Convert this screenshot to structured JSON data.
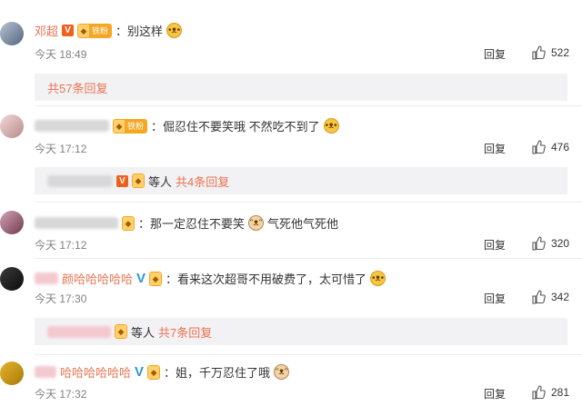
{
  "comments": [
    {
      "username": "邓超",
      "badge_text": "铁粉",
      "text": "：别这样",
      "time": "今天 18:49",
      "reply_label": "回复",
      "likes": "522",
      "sub_replies": "共57条回复"
    },
    {
      "badge_text": "铁粉",
      "text": "：倔忍住不要笑哦 不然吃不到了",
      "time": "今天 17:12",
      "reply_label": "回复",
      "likes": "476",
      "sub_others": "等人",
      "sub_replies": "共4条回复"
    },
    {
      "text": "：那一定忍住不要笑",
      "text_after": "气死他气死他",
      "time": "今天 17:12",
      "reply_label": "回复",
      "likes": "320"
    },
    {
      "username_visible": "颜哈哈哈哈哈",
      "text": "：看来这次超哥不用破费了，太可惜了",
      "time": "今天 17:30",
      "reply_label": "回复",
      "likes": "342",
      "sub_others": "等人",
      "sub_replies": "共7条回复"
    },
    {
      "username_visible": "哈哈哈哈哈哈",
      "text": "：姐，千万忍住了哦",
      "time": "今天 17:32",
      "reply_label": "回复",
      "likes": "281"
    }
  ],
  "colors": {
    "username": "#eb7350",
    "sub_reply_bg": "#f2f2f5",
    "meta": "#808080",
    "verified_orange": "#f05f1c",
    "verified_blue": "#2c95de"
  },
  "icons": {
    "like": "thumbs-up-icon",
    "emoji": "doge-emoji-icon",
    "cat_emoji": "cat-emoji-icon"
  }
}
